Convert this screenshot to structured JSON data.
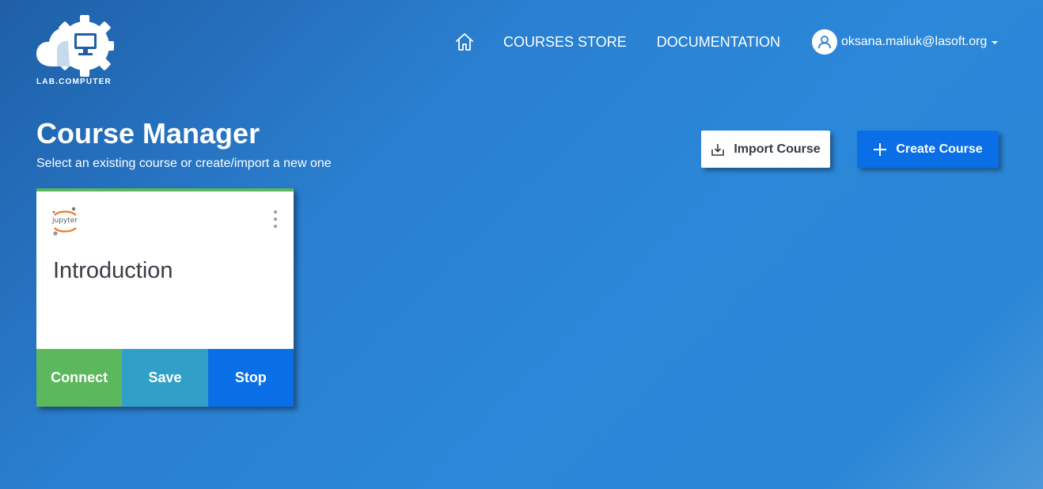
{
  "brand": {
    "name": "LAB.COMPUTER",
    "logo_icon": "cloud-gear-monitor-icon"
  },
  "nav": {
    "home_icon": "home-icon",
    "courses_store": "COURSES STORE",
    "documentation": "DOCUMENTATION"
  },
  "user": {
    "email": "oksana.maliuk@lasoft.org",
    "avatar_icon": "user-icon"
  },
  "page": {
    "title": "Course Manager",
    "subtitle": "Select an existing course or create/import a new one"
  },
  "actions": {
    "import_label": "Import Course",
    "import_icon": "import-icon",
    "create_label": "Create Course",
    "create_icon": "plus-icon"
  },
  "courses": [
    {
      "title": "Introduction",
      "logo_text": "jupyter",
      "status_color": "#5cb85c",
      "buttons": {
        "connect": "Connect",
        "save": "Save",
        "stop": "Stop"
      }
    }
  ],
  "colors": {
    "primary": "#0a6fe6",
    "success": "#5cb85c",
    "info": "#31a0c8",
    "background": "#2a7fd0"
  }
}
